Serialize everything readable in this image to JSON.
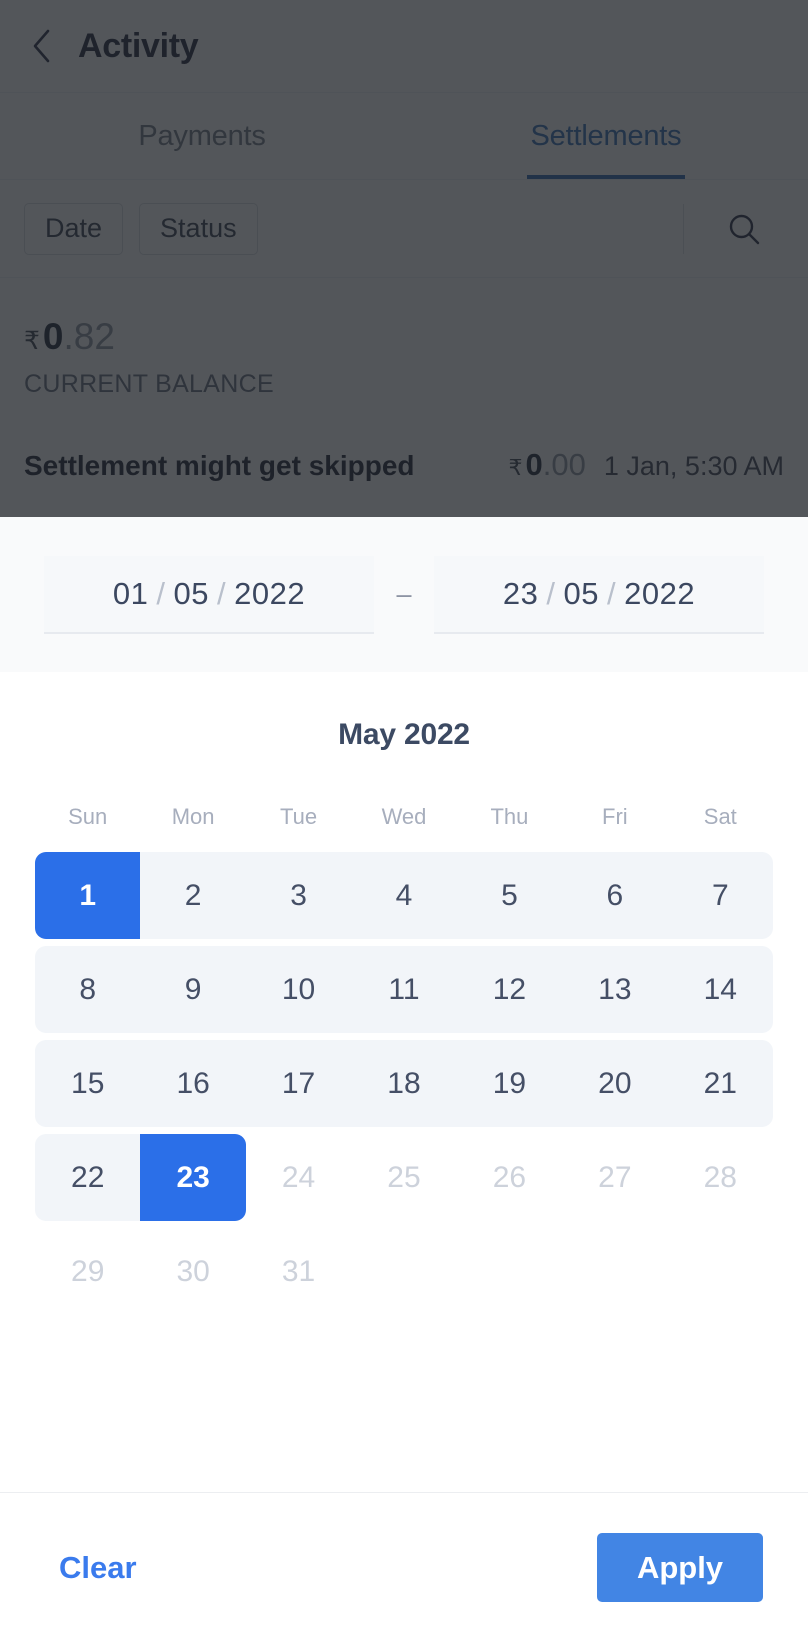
{
  "background": {
    "header": {
      "back_icon": "chevron-left-icon",
      "title": "Activity"
    },
    "tabs": [
      {
        "label": "Payments",
        "active": false
      },
      {
        "label": "Settlements",
        "active": true
      }
    ],
    "filters": {
      "chips": [
        "Date",
        "Status"
      ],
      "search_icon": "search-icon"
    },
    "balance": {
      "currency": "₹",
      "whole": "0",
      "decimal": ".82",
      "label": "CURRENT BALANCE"
    },
    "settlement_row": {
      "title": "Settlement might get skipped",
      "currency": "₹",
      "amount_whole": "0",
      "amount_decimal": ".00",
      "date": "1 Jan, 5:30 AM"
    }
  },
  "sheet": {
    "range": {
      "start": {
        "day": "01",
        "month": "05",
        "year": "2022"
      },
      "separator": "–",
      "end": {
        "day": "23",
        "month": "05",
        "year": "2022"
      }
    },
    "calendar": {
      "title": "May 2022",
      "weekdays": [
        "Sun",
        "Mon",
        "Tue",
        "Wed",
        "Thu",
        "Fri",
        "Sat"
      ],
      "weeks": [
        [
          {
            "label": "1",
            "state": "selected-start"
          },
          {
            "label": "2",
            "state": "in-range"
          },
          {
            "label": "3",
            "state": "in-range"
          },
          {
            "label": "4",
            "state": "in-range"
          },
          {
            "label": "5",
            "state": "in-range"
          },
          {
            "label": "6",
            "state": "in-range"
          },
          {
            "label": "7",
            "state": "in-range"
          }
        ],
        [
          {
            "label": "8",
            "state": "in-range"
          },
          {
            "label": "9",
            "state": "in-range"
          },
          {
            "label": "10",
            "state": "in-range"
          },
          {
            "label": "11",
            "state": "in-range"
          },
          {
            "label": "12",
            "state": "in-range"
          },
          {
            "label": "13",
            "state": "in-range"
          },
          {
            "label": "14",
            "state": "in-range"
          }
        ],
        [
          {
            "label": "15",
            "state": "in-range"
          },
          {
            "label": "16",
            "state": "in-range"
          },
          {
            "label": "17",
            "state": "in-range"
          },
          {
            "label": "18",
            "state": "in-range"
          },
          {
            "label": "19",
            "state": "in-range"
          },
          {
            "label": "20",
            "state": "in-range"
          },
          {
            "label": "21",
            "state": "in-range"
          }
        ],
        [
          {
            "label": "22",
            "state": "in-range"
          },
          {
            "label": "23",
            "state": "selected-end"
          },
          {
            "label": "24",
            "state": "disabled"
          },
          {
            "label": "25",
            "state": "disabled"
          },
          {
            "label": "26",
            "state": "disabled"
          },
          {
            "label": "27",
            "state": "disabled"
          },
          {
            "label": "28",
            "state": "disabled"
          }
        ],
        [
          {
            "label": "29",
            "state": "disabled"
          },
          {
            "label": "30",
            "state": "disabled"
          },
          {
            "label": "31",
            "state": "disabled"
          },
          {
            "label": "",
            "state": "blank"
          },
          {
            "label": "",
            "state": "blank"
          },
          {
            "label": "",
            "state": "blank"
          },
          {
            "label": "",
            "state": "blank"
          }
        ]
      ]
    },
    "footer": {
      "clear_label": "Clear",
      "apply_label": "Apply"
    }
  },
  "colors": {
    "accent_blue": "#2b6fe8",
    "apply_blue": "#4285e4",
    "link_blue": "#3a7bed",
    "range_band": "#f2f5f9",
    "overlay": "rgba(35,38,44,0.78)"
  }
}
